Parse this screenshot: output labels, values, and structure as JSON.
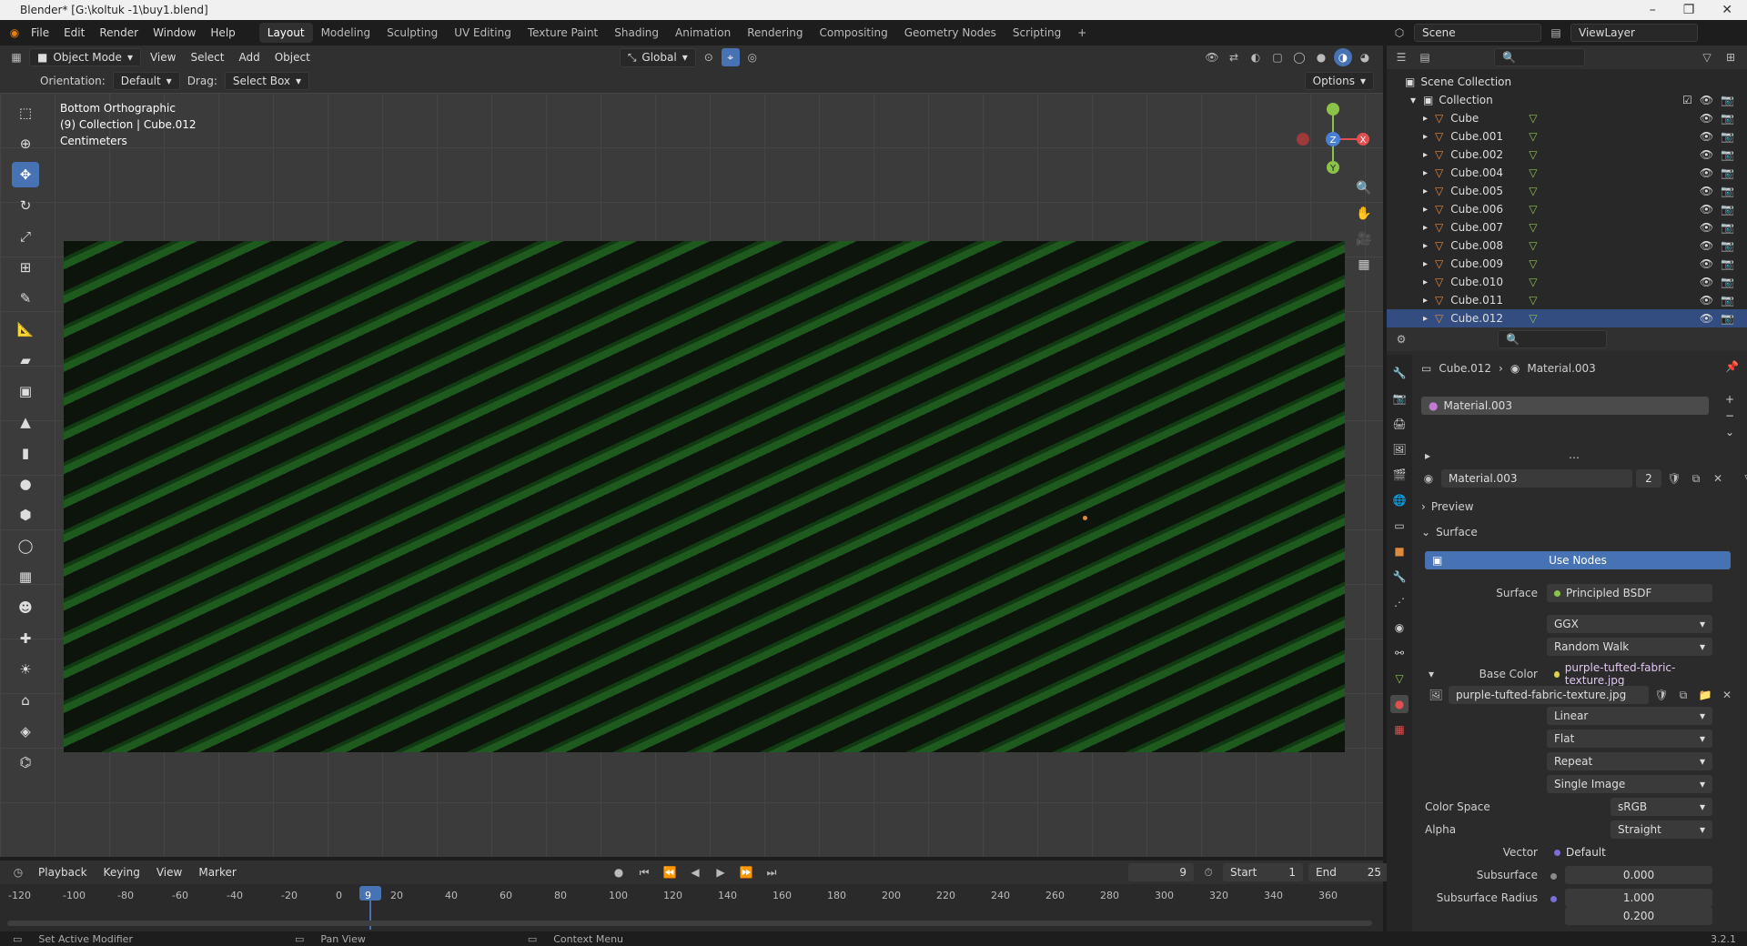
{
  "window": {
    "title": "Blender* [G:\\koltuk -1\\buy1.blend]",
    "controls": [
      "–",
      "❐",
      "✕"
    ]
  },
  "menu": {
    "items": [
      "File",
      "Edit",
      "Render",
      "Window",
      "Help"
    ]
  },
  "workspaces": [
    {
      "label": "Layout",
      "active": true
    },
    {
      "label": "Modeling"
    },
    {
      "label": "Sculpting"
    },
    {
      "label": "UV Editing"
    },
    {
      "label": "Texture Paint"
    },
    {
      "label": "Shading"
    },
    {
      "label": "Animation"
    },
    {
      "label": "Rendering"
    },
    {
      "label": "Compositing"
    },
    {
      "label": "Geometry Nodes"
    },
    {
      "label": "Scripting"
    },
    {
      "label": "+"
    }
  ],
  "scene": {
    "name": "Scene",
    "view_layer": "ViewLayer"
  },
  "viewport_header": {
    "mode": "Object Mode",
    "menus": [
      "View",
      "Select",
      "Add",
      "Object"
    ],
    "transform": "Global"
  },
  "tool_settings": {
    "orientation_label": "Orientation:",
    "orientation": "Default",
    "drag_label": "Drag:",
    "drag": "Select Box",
    "options": "Options"
  },
  "viewport_info": {
    "view": "Bottom Orthographic",
    "collection": "(9) Collection | Cube.012",
    "units": "Centimeters"
  },
  "gizmo": {
    "x": "X",
    "y": "Y",
    "z": "Z"
  },
  "timeline": {
    "menus": [
      "Playback",
      "Keying",
      "View",
      "Marker"
    ],
    "current_frame": "9",
    "start_label": "Start",
    "start": "1",
    "end_label": "End",
    "end": "25",
    "ruler": [
      "-120",
      "-100",
      "-80",
      "-60",
      "-40",
      "-20",
      "0",
      "9",
      "20",
      "40",
      "60",
      "80",
      "100",
      "120",
      "140",
      "160",
      "180",
      "200",
      "220",
      "240",
      "260",
      "280",
      "300",
      "320",
      "340",
      "360"
    ]
  },
  "status": {
    "items": [
      "Set Active Modifier",
      "Pan View",
      "Context Menu"
    ],
    "version": "3.2.1"
  },
  "outliner": {
    "root": "Scene Collection",
    "collection": "Collection",
    "objects": [
      "Cube",
      "Cube.001",
      "Cube.002",
      "Cube.004",
      "Cube.005",
      "Cube.006",
      "Cube.007",
      "Cube.008",
      "Cube.009",
      "Cube.010",
      "Cube.011",
      "Cube.012"
    ]
  },
  "properties": {
    "breadcrumb_object": "Cube.012",
    "breadcrumb_material": "Material.003",
    "slot": "Material.003",
    "datablock": "Material.003",
    "users": "2",
    "panels": {
      "preview": "Preview",
      "surface": "Surface"
    },
    "use_nodes": "Use Nodes",
    "surface_label": "Surface",
    "surface_value": "Principled BSDF",
    "distribution": "GGX",
    "subsurface_method": "Random Walk",
    "base_color_label": "Base Color",
    "base_color_value": "purple-tufted-fabric-texture.jpg",
    "image_name": "purple-tufted-fabric-texture.jpg",
    "interpolation": "Linear",
    "projection": "Flat",
    "extension": "Repeat",
    "source": "Single Image",
    "color_space_label": "Color Space",
    "color_space": "sRGB",
    "alpha_label": "Alpha",
    "alpha": "Straight",
    "vector_label": "Vector",
    "vector": "Default",
    "subsurface_label": "Subsurface",
    "subsurface": "0.000",
    "subsurface_radius_label": "Subsurface Radius",
    "subsurface_radius_1": "1.000",
    "subsurface_radius_2": "0.200"
  },
  "colors": {
    "accent": "#4772b3",
    "texture_green": "#1e5a1e",
    "object_orange": "#e08a3c"
  }
}
